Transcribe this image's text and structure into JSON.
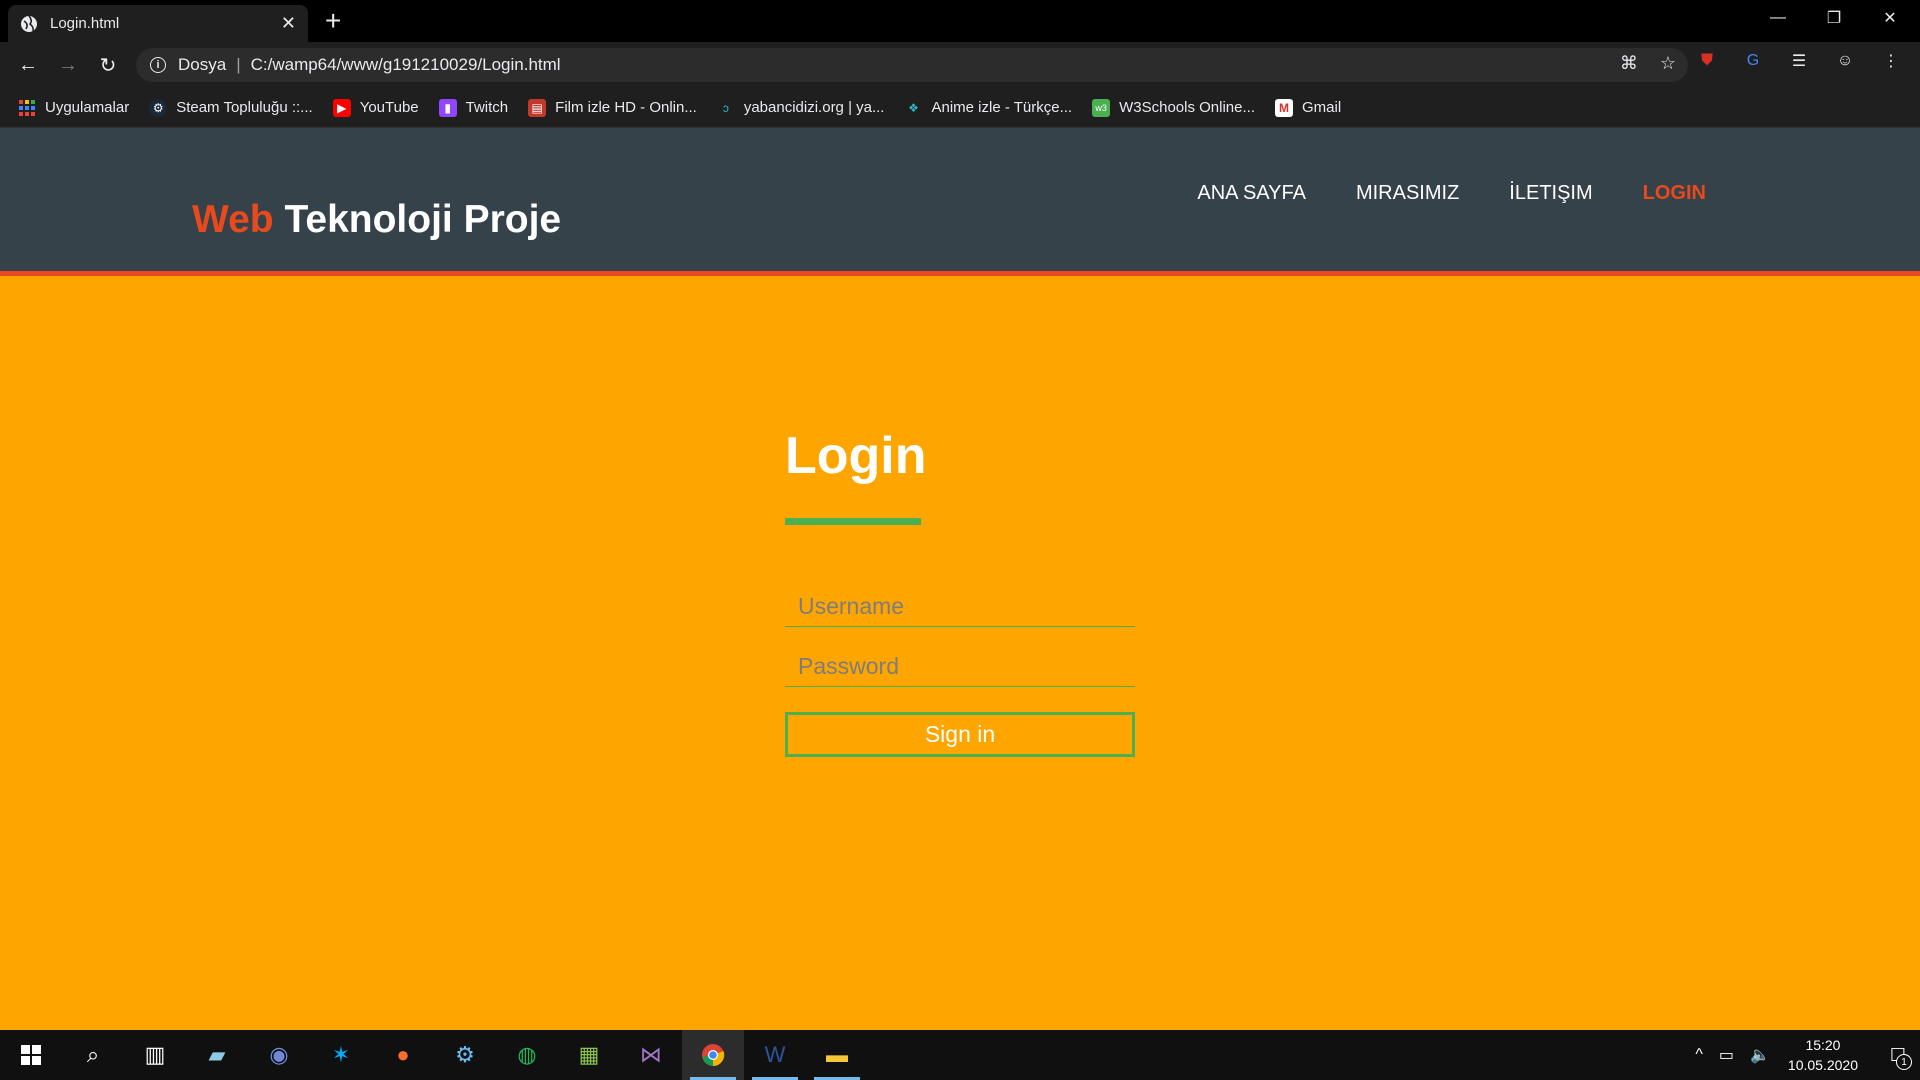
{
  "browser": {
    "tab_title": "Login.html",
    "tab_close": "✕",
    "new_tab": "+",
    "address_scheme": "Dosya",
    "address_url": "C:/wamp64/www/g191210029/Login.html",
    "bookmarks": [
      {
        "label": "Uygulamalar",
        "icon": "apps-grid-icon",
        "color": "#ea4335"
      },
      {
        "label": "Steam Topluluğu ::...",
        "icon": "steam-icon",
        "color": "#1b2838"
      },
      {
        "label": "YouTube",
        "icon": "youtube-icon",
        "color": "#ff0000"
      },
      {
        "label": "Twitch",
        "icon": "twitch-icon",
        "color": "#9146ff"
      },
      {
        "label": "Film izle HD - Onlin...",
        "icon": "film-icon",
        "color": "#c0392b"
      },
      {
        "label": "yabancidizi.org | ya...",
        "icon": "yabancidizi-icon",
        "color": "#1f1f1f"
      },
      {
        "label": "Anime izle - Türkçe...",
        "icon": "anime-icon",
        "color": "#1f1f1f"
      },
      {
        "label": "W3Schools Online...",
        "icon": "w3schools-icon",
        "color": "#4caf50"
      },
      {
        "label": "Gmail",
        "icon": "gmail-icon",
        "color": "#ffffff"
      }
    ]
  },
  "site": {
    "brand_highlight": "Web",
    "brand_rest": " Teknoloji Proje",
    "nav": [
      {
        "label": "ANA SAYFA"
      },
      {
        "label": "MIRASIMIZ"
      },
      {
        "label": "İLETIŞIM"
      },
      {
        "label": "LOGIN"
      }
    ],
    "colors": {
      "header": "#35424a",
      "accent": "#e8491d",
      "page_bg": "#ffa500",
      "green": "#4caf50"
    }
  },
  "login": {
    "title": "Login",
    "username_placeholder": "Username",
    "password_placeholder": "Password",
    "submit_label": "Sign in"
  },
  "taskbar": {
    "time": "15:20",
    "date": "10.05.2020",
    "notification_count": "1"
  }
}
